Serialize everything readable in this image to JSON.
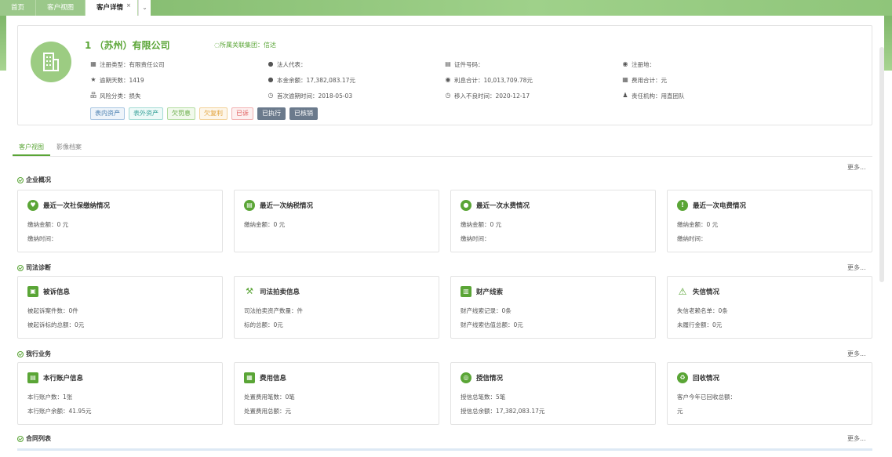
{
  "tabs": [
    {
      "label": "首页"
    },
    {
      "label": "客户视图"
    },
    {
      "label": "客户详情",
      "close": "×"
    }
  ],
  "tab_caret": "⌄",
  "company": {
    "name": "1 （苏州）有限公司",
    "group": "所属关联集团：信达"
  },
  "info": [
    [
      "注册类型：有限责任公司",
      "法人代表：",
      "证件号码：",
      "注册地："
    ],
    [
      "逾期天数：1419",
      "本金余额：17,382,083.17元",
      "利息合计：10,013,709.78元",
      "费用合计：元"
    ],
    [
      "风险分类：损失",
      "首次逾期时间：2018-05-03",
      "移入不良时间：2020-12-17",
      "责任机构：用直团队"
    ]
  ],
  "badges": [
    "表内资产",
    "表外资产",
    "欠罚息",
    "欠复利",
    "已诉",
    "已执行",
    "已核销"
  ],
  "subtabs": [
    "客户视图",
    "影像档案"
  ],
  "more_label": "更多...",
  "sections": {
    "enterprise": {
      "title": "企业概况",
      "cards": [
        {
          "title": "最近一次社保缴纳情况",
          "lines": [
            "缴纳金额：0 元",
            "缴纳时间："
          ]
        },
        {
          "title": "最近一次纳税情况",
          "lines": [
            "缴纳金额：0 元"
          ]
        },
        {
          "title": "最近一次水费情况",
          "lines": [
            "缴纳金额：0 元",
            "缴纳时间："
          ]
        },
        {
          "title": "最近一次电费情况",
          "lines": [
            "缴纳金额：0 元",
            "缴纳时间："
          ]
        }
      ]
    },
    "judicial": {
      "title": "司法诊断",
      "cards": [
        {
          "title": "被诉信息",
          "lines": [
            "被起诉案件数：0件",
            "被起诉标的总额：0元"
          ]
        },
        {
          "title": "司法拍卖信息",
          "lines": [
            "司法拍卖资产数量：件",
            "标的总额：0元"
          ]
        },
        {
          "title": "财产线索",
          "lines": [
            "财产线索记录：0条",
            "财产线索估值总额：0元"
          ]
        },
        {
          "title": "失信情况",
          "lines": [
            "失信老赖名单：0条",
            "未履行金额：0元"
          ]
        }
      ]
    },
    "business": {
      "title": "我行业务",
      "cards": [
        {
          "title": "本行账户信息",
          "lines": [
            "本行账户数：1张",
            "本行账户余额：41.95元"
          ]
        },
        {
          "title": "费用信息",
          "lines": [
            "处置费用笔数：0笔",
            "处置费用总额：元"
          ]
        },
        {
          "title": "授信情况",
          "lines": [
            "授信总笔数：5笔",
            "授信总余额：17,382,083.17元"
          ]
        },
        {
          "title": "回收情况",
          "lines": [
            "客户今年已回收总额：",
            "元"
          ]
        }
      ]
    },
    "contracts": {
      "title": "合同列表"
    }
  },
  "colors": {
    "accent": "#5aa536",
    "band": "#8fc57a"
  }
}
